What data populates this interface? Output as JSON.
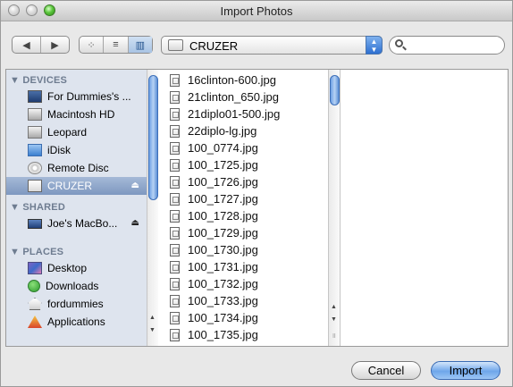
{
  "window": {
    "title": "Import Photos"
  },
  "toolbar": {
    "back_glyph": "◀",
    "forward_glyph": "▶",
    "view_icons": [
      "⁘",
      "≡",
      "▥"
    ],
    "location": "CRUZER",
    "search_placeholder": ""
  },
  "sidebar": {
    "devices_header": "DEVICES",
    "devices": [
      {
        "label": "For Dummies's ...",
        "icon": "computer-icon"
      },
      {
        "label": "Macintosh HD",
        "icon": "hard-disk-icon"
      },
      {
        "label": "Leopard",
        "icon": "hard-disk-icon"
      },
      {
        "label": "iDisk",
        "icon": "idisk-icon"
      },
      {
        "label": "Remote Disc",
        "icon": "disc-icon"
      },
      {
        "label": "CRUZER",
        "icon": "usb-drive-icon",
        "selected": true
      }
    ],
    "shared_header": "SHARED",
    "shared": [
      {
        "label": "Joe's MacBo...",
        "icon": "laptop-icon"
      }
    ],
    "places_header": "PLACES",
    "places": [
      {
        "label": "Desktop",
        "icon": "desktop-icon"
      },
      {
        "label": "Downloads",
        "icon": "downloads-icon"
      },
      {
        "label": "fordummies",
        "icon": "home-icon"
      },
      {
        "label": "Applications",
        "icon": "applications-icon"
      }
    ]
  },
  "files": [
    "16clinton-600.jpg",
    "21clinton_650.jpg",
    "21diplo01-500.jpg",
    "22diplo-lg.jpg",
    "100_0774.jpg",
    "100_1725.jpg",
    "100_1726.jpg",
    "100_1727.jpg",
    "100_1728.jpg",
    "100_1729.jpg",
    "100_1730.jpg",
    "100_1731.jpg",
    "100_1732.jpg",
    "100_1733.jpg",
    "100_1734.jpg",
    "100_1735.jpg"
  ],
  "buttons": {
    "cancel": "Cancel",
    "import": "Import"
  },
  "colors": {
    "sidebar_bg": "#dee4ee",
    "selection": "#7e98c0",
    "accent": "#6ea6ea"
  }
}
